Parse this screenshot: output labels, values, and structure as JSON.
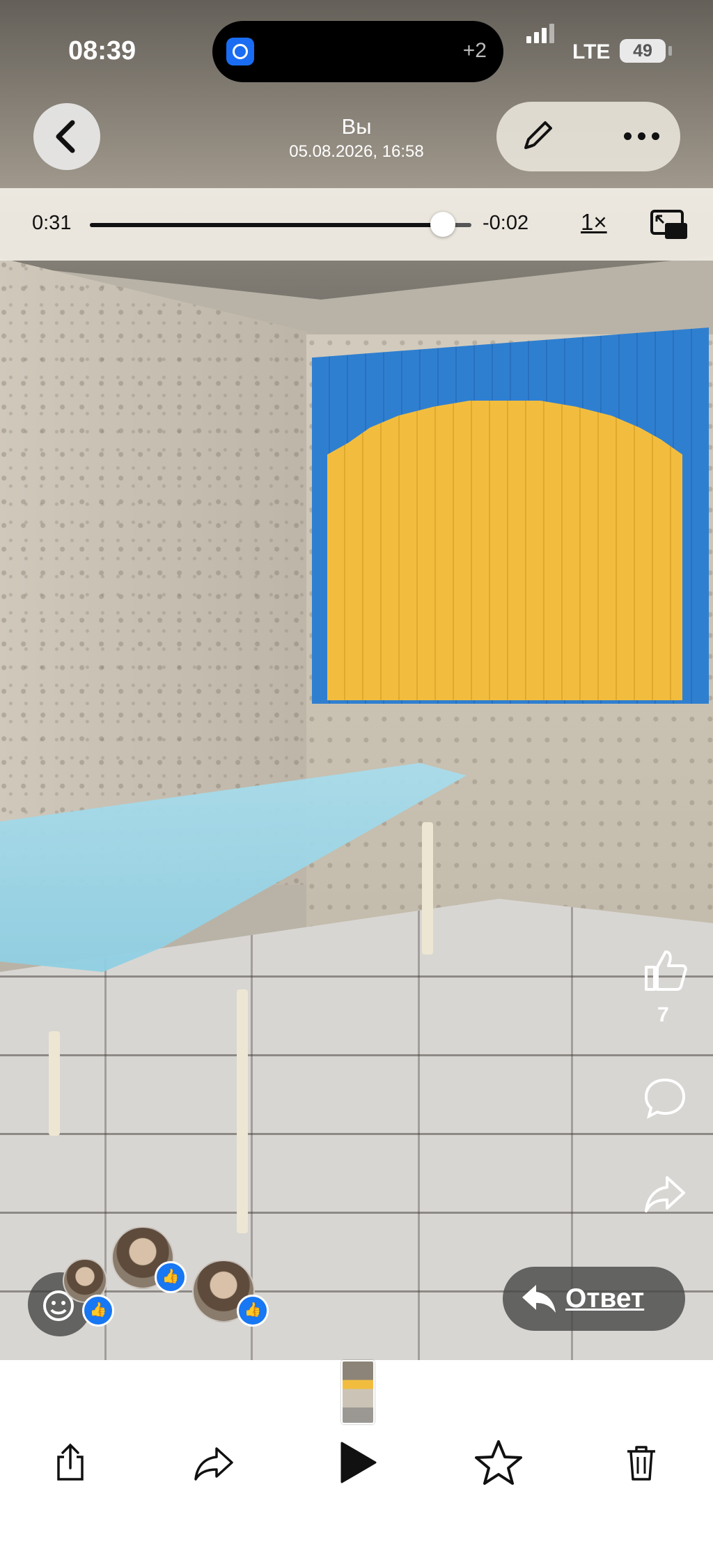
{
  "status_bar": {
    "time": "08:39",
    "island_badge": "+2",
    "network": "LTE",
    "battery": "49"
  },
  "header": {
    "back_icon": "chevron-left-icon",
    "title": "Вы",
    "subtitle": "05.08.2026, 16:58",
    "edit_icon": "pencil-icon",
    "more_icon": "ellipsis-icon"
  },
  "playback": {
    "elapsed": "0:31",
    "remaining": "-0:02",
    "progress": 0.94,
    "speed": "1×",
    "pip_icon": "picture-in-picture-icon"
  },
  "reactions": {
    "like_count": "7",
    "like_icon": "thumbs-up-icon",
    "comment_icon": "comment-bubble-icon",
    "share_icon": "share-arrow-icon"
  },
  "reply": {
    "label": "Ответ",
    "icon": "reply-arrow-icon"
  },
  "toolbar": {
    "share_icon": "share-upload-icon",
    "forward_icon": "forward-icon",
    "play_icon": "play-icon",
    "favorite_icon": "star-icon",
    "delete_icon": "trash-icon"
  },
  "colors": {
    "accent_blue": "#1877f2",
    "blind_blue": "#2f7fd0",
    "blind_yellow": "#f2bd3f",
    "sheet_blue": "#a9dceb"
  }
}
